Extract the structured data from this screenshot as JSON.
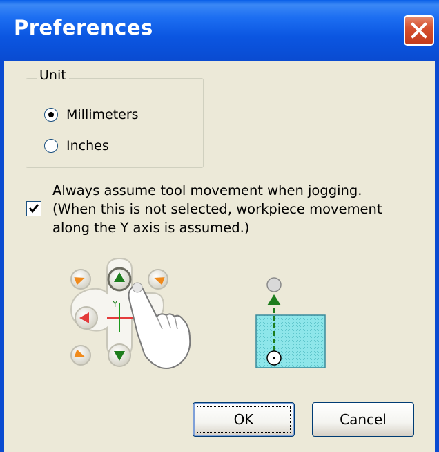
{
  "window": {
    "title": "Preferences"
  },
  "unit_group": {
    "legend": "Unit",
    "options": [
      {
        "label": "Millimeters",
        "selected": true
      },
      {
        "label": "Inches",
        "selected": false
      }
    ]
  },
  "tool_movement": {
    "checked": true,
    "lines": [
      "Always assume tool movement when jogging.",
      "(When this is not selected, workpiece movement",
      "along the Y axis is assumed.)"
    ]
  },
  "illustration": {
    "axis_label": "Y"
  },
  "buttons": {
    "ok_label": "OK",
    "cancel_label": "Cancel"
  },
  "colors": {
    "titlebar": "#0a4bd1",
    "close": "#d6512f",
    "dialog_bg": "#ece9d8",
    "workpiece": "#8ee6ea",
    "jog_orange": "#f08a1c",
    "jog_green": "#1d7d1d",
    "jog_red": "#e43c3c"
  }
}
